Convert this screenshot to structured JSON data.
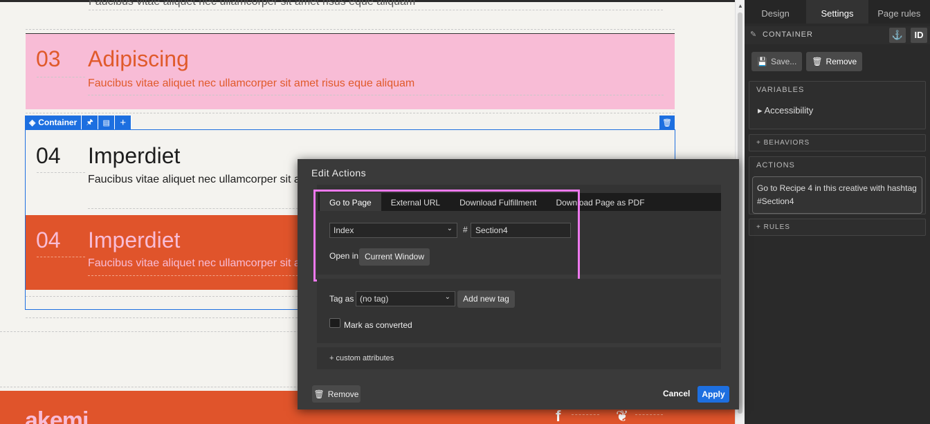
{
  "canvas": {
    "partial_text": "Faucibus vitae aliquet nec ullamcorper sit amet risus eque aliquam",
    "sections": [
      {
        "num": "03",
        "title": "Adipiscing",
        "desc": "Faucibus vitae aliquet nec ullamcorper sit amet risus eque aliquam"
      },
      {
        "num": "04",
        "title": "Imperdiet",
        "desc": "Faucibus vitae aliquet nec ullamcorper sit a"
      },
      {
        "num": "04",
        "title": "Imperdiet",
        "desc": "Faucibus vitae aliquet nec ullamcorper sit a"
      }
    ],
    "selection_label": "Container",
    "footer_logo": "akemi"
  },
  "panel": {
    "tabs": [
      "Design",
      "Settings",
      "Page rules"
    ],
    "active_tab": "Settings",
    "element_name": "CONTAINER",
    "id_label": "ID",
    "save_label": "Save...",
    "remove_label": "Remove",
    "variables_header": "VARIABLES",
    "accessibility_label": "Accessibility",
    "behaviors_header": "+ BEHAVIORS",
    "actions_header": "ACTIONS",
    "action_summary": "Go to Recipe 4 in this creative with hashtag #Section4",
    "rules_header": "+ RULES"
  },
  "modal": {
    "title": "Edit Actions",
    "tabs": [
      "Go to Page",
      "External URL",
      "Download Fulfillment",
      "Download Page as PDF"
    ],
    "page_select": "Index",
    "hash_symbol": "#",
    "hash_value": "Section4",
    "open_in_label": "Open in",
    "open_in_value": "Current Window",
    "tag_as_label": "Tag as",
    "tag_select": "(no tag)",
    "add_tag_label": "Add new tag",
    "mark_converted_label": "Mark as converted",
    "custom_attributes_label": "+ custom attributes",
    "remove_label": "Remove",
    "cancel_label": "Cancel",
    "apply_label": "Apply"
  },
  "colors": {
    "accent": "#1d6fe0",
    "highlight": "#ee79ee",
    "orange": "#e0542b",
    "pink": "#f8bcd6"
  }
}
